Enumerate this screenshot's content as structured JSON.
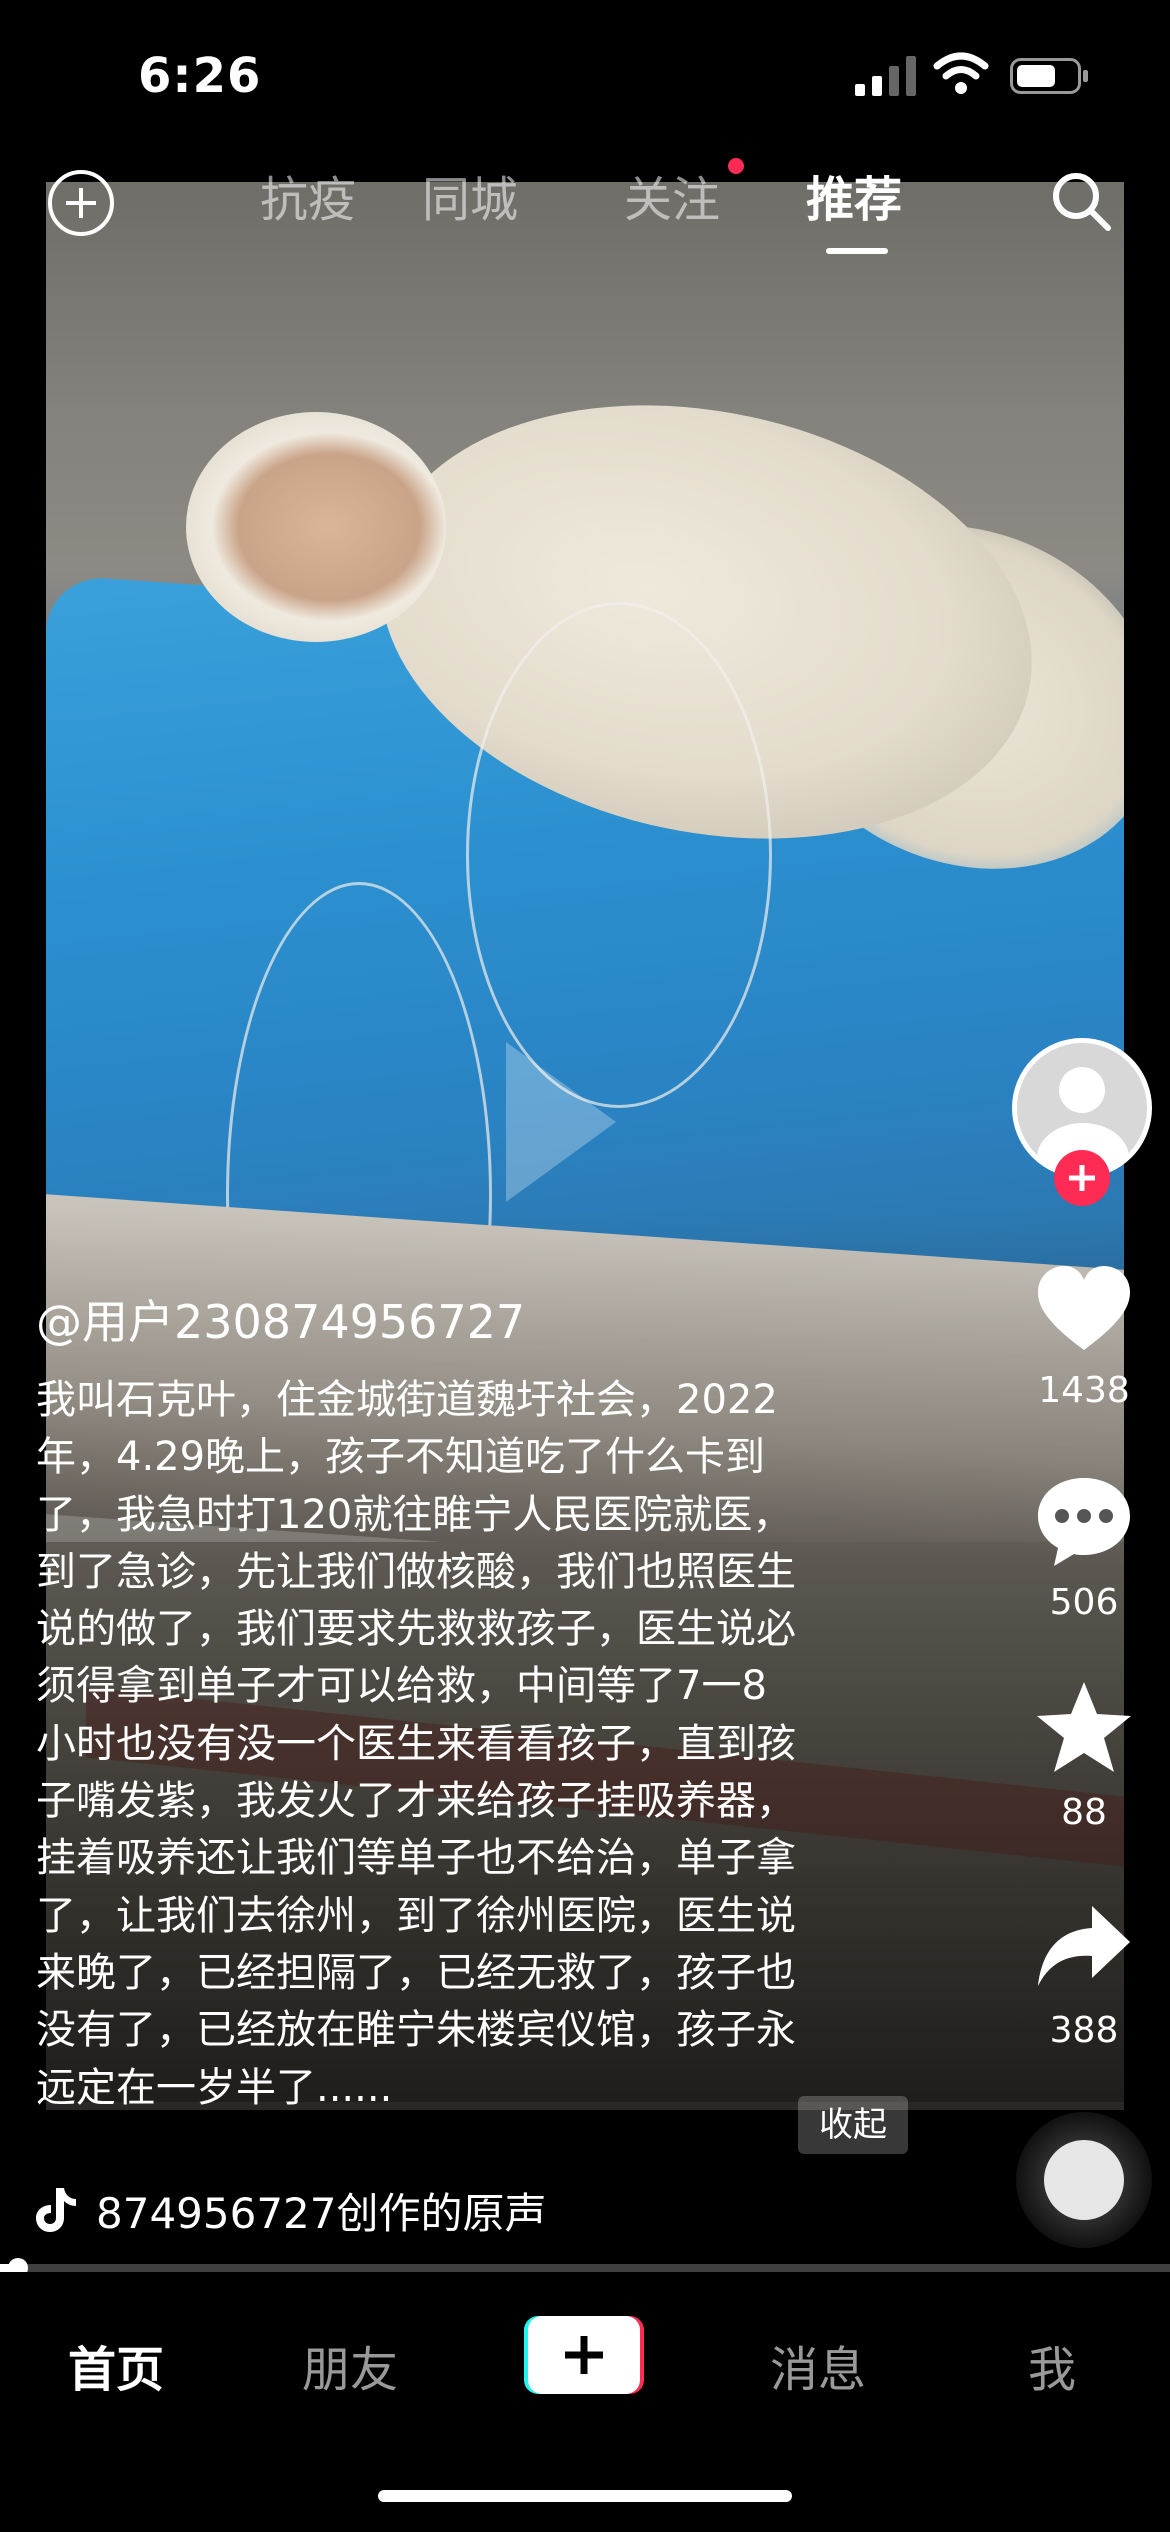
{
  "status_bar": {
    "time": "6:26"
  },
  "top_tabs": [
    {
      "label": "抗疫",
      "active": false
    },
    {
      "label": "同城",
      "active": false
    },
    {
      "label": "关注",
      "active": false,
      "has_dot": true
    },
    {
      "label": "推荐",
      "active": true
    }
  ],
  "post": {
    "author": "@用户230874956727",
    "description_lines": [
      "我叫石克叶，住金城街道魏圩社会，2022",
      "年，4.29晚上，孩子不知道吃了什么卡到",
      "了，我急时打120就往睢宁人民医院就医，",
      "到了急诊，先让我们做核酸，我们也照医生",
      "说的做了，我们要求先救救孩子，医生说必",
      "须得拿到单子才可以给救，中间等了7一8",
      "小时也没有没一个医生来看看孩子，直到孩",
      "子嘴发紫，我发火了才来给孩子挂吸养器，",
      "挂着吸养还让我们等单子也不给治，单子拿",
      "了，让我们去徐州，到了徐州医院，医生说",
      "来晚了，已经担隔了，已经无救了，孩子也",
      "没有了，已经放在睢宁朱楼宾仪馆，孩子永",
      "远定在一岁半了......"
    ],
    "collapse_label": "收起",
    "music_text": "874956727创作的原声"
  },
  "actions": {
    "likes": "1438",
    "comments": "506",
    "favorites": "88",
    "shares": "388"
  },
  "progress": 0.015,
  "bottom_nav": {
    "home": "首页",
    "friends": "朋友",
    "messages": "消息",
    "me": "我"
  },
  "colors": {
    "accent": "#fe2c55",
    "accent_cyan": "#25f4ee",
    "background": "#000000"
  },
  "icons": [
    "add-circle-icon",
    "search-icon",
    "heart-icon",
    "comment-icon",
    "star-icon",
    "share-icon",
    "music-note-icon",
    "play-icon"
  ]
}
